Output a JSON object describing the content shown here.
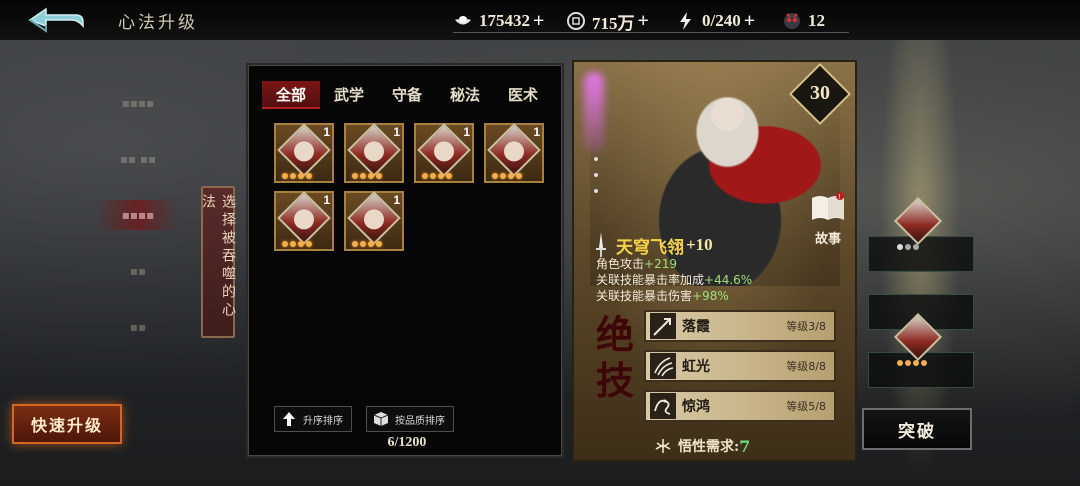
{
  "header": {
    "title": "心法升级",
    "resources": [
      {
        "icon": "silver-ingot-icon",
        "value": "175432"
      },
      {
        "icon": "coin-icon",
        "value": "715万"
      },
      {
        "icon": "lightning-icon",
        "value": "0/240"
      },
      {
        "icon": "demon-mask-icon",
        "value": "12"
      }
    ],
    "plus": "+"
  },
  "left_menu": {
    "vertical_label": "选择被吞噬的心法",
    "quick_upgrade": "快速升级"
  },
  "inventory": {
    "tabs": [
      "全部",
      "武学",
      "守备",
      "秘法",
      "医术"
    ],
    "active_tab": 0,
    "cards": [
      {
        "level": "1",
        "stars": 4
      },
      {
        "level": "1",
        "stars": 4
      },
      {
        "level": "1",
        "stars": 4
      },
      {
        "level": "1",
        "stars": 4
      },
      {
        "level": "1",
        "stars": 4
      },
      {
        "level": "1",
        "stars": 4
      }
    ],
    "sort_asc": "升序排序",
    "sort_quality": "按品质排序",
    "count": "6/1200"
  },
  "detail": {
    "level": "30",
    "story": "故事",
    "name": "天穹飞翎",
    "plus": "+10",
    "stats": [
      {
        "label": "角色攻击",
        "value": "+219"
      },
      {
        "label": "关联技能暴击率加成",
        "value": "+44.6%"
      },
      {
        "label": "关联技能暴击伤害",
        "value": "+98%"
      }
    ],
    "jueji": "绝技",
    "skills": [
      {
        "name": "落霞",
        "level": "等级3/8",
        "icon": "arrow-icon"
      },
      {
        "name": "虹光",
        "level": "等级8/8",
        "icon": "claw-icon"
      },
      {
        "name": "惊鸿",
        "level": "等级5/8",
        "icon": "dragon-icon"
      }
    ],
    "requirement_label": "悟性需求:",
    "requirement_value": "7"
  },
  "right": {
    "break_button": "突破"
  },
  "colors": {
    "accent_red": "#7d1414",
    "quick_btn_border": "#d3671f",
    "name_gold": "#f6d24a",
    "stat_green": "#9ee07a"
  }
}
